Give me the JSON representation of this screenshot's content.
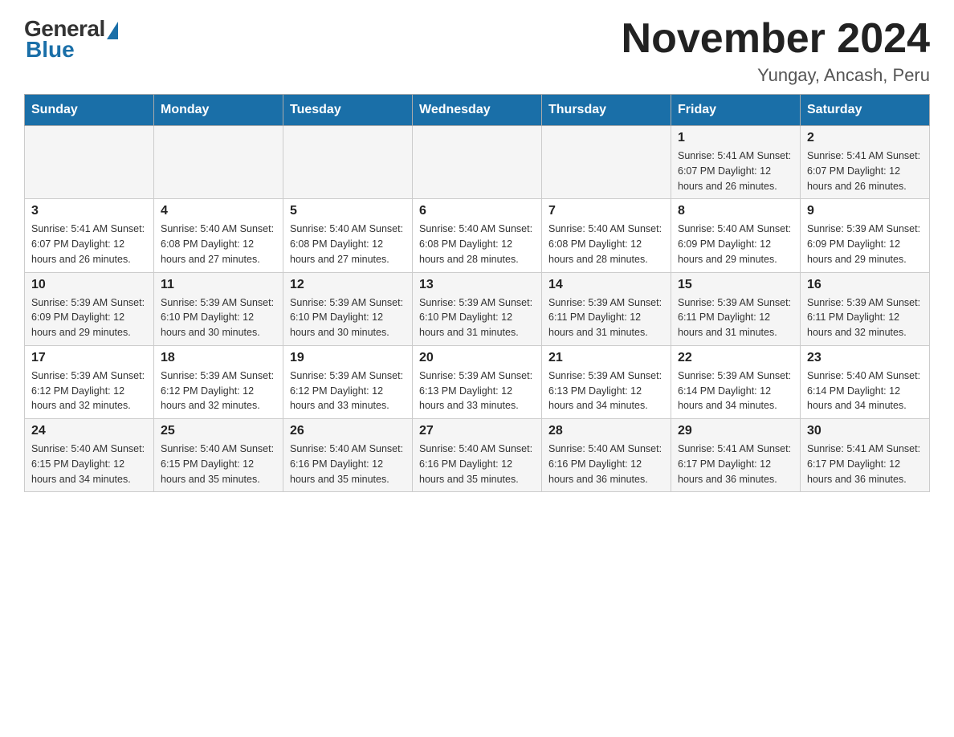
{
  "header": {
    "logo_general": "General",
    "logo_blue": "Blue",
    "month_title": "November 2024",
    "subtitle": "Yungay, Ancash, Peru"
  },
  "weekdays": [
    "Sunday",
    "Monday",
    "Tuesday",
    "Wednesday",
    "Thursday",
    "Friday",
    "Saturday"
  ],
  "weeks": [
    [
      {
        "day": "",
        "info": ""
      },
      {
        "day": "",
        "info": ""
      },
      {
        "day": "",
        "info": ""
      },
      {
        "day": "",
        "info": ""
      },
      {
        "day": "",
        "info": ""
      },
      {
        "day": "1",
        "info": "Sunrise: 5:41 AM\nSunset: 6:07 PM\nDaylight: 12 hours and 26 minutes."
      },
      {
        "day": "2",
        "info": "Sunrise: 5:41 AM\nSunset: 6:07 PM\nDaylight: 12 hours and 26 minutes."
      }
    ],
    [
      {
        "day": "3",
        "info": "Sunrise: 5:41 AM\nSunset: 6:07 PM\nDaylight: 12 hours and 26 minutes."
      },
      {
        "day": "4",
        "info": "Sunrise: 5:40 AM\nSunset: 6:08 PM\nDaylight: 12 hours and 27 minutes."
      },
      {
        "day": "5",
        "info": "Sunrise: 5:40 AM\nSunset: 6:08 PM\nDaylight: 12 hours and 27 minutes."
      },
      {
        "day": "6",
        "info": "Sunrise: 5:40 AM\nSunset: 6:08 PM\nDaylight: 12 hours and 28 minutes."
      },
      {
        "day": "7",
        "info": "Sunrise: 5:40 AM\nSunset: 6:08 PM\nDaylight: 12 hours and 28 minutes."
      },
      {
        "day": "8",
        "info": "Sunrise: 5:40 AM\nSunset: 6:09 PM\nDaylight: 12 hours and 29 minutes."
      },
      {
        "day": "9",
        "info": "Sunrise: 5:39 AM\nSunset: 6:09 PM\nDaylight: 12 hours and 29 minutes."
      }
    ],
    [
      {
        "day": "10",
        "info": "Sunrise: 5:39 AM\nSunset: 6:09 PM\nDaylight: 12 hours and 29 minutes."
      },
      {
        "day": "11",
        "info": "Sunrise: 5:39 AM\nSunset: 6:10 PM\nDaylight: 12 hours and 30 minutes."
      },
      {
        "day": "12",
        "info": "Sunrise: 5:39 AM\nSunset: 6:10 PM\nDaylight: 12 hours and 30 minutes."
      },
      {
        "day": "13",
        "info": "Sunrise: 5:39 AM\nSunset: 6:10 PM\nDaylight: 12 hours and 31 minutes."
      },
      {
        "day": "14",
        "info": "Sunrise: 5:39 AM\nSunset: 6:11 PM\nDaylight: 12 hours and 31 minutes."
      },
      {
        "day": "15",
        "info": "Sunrise: 5:39 AM\nSunset: 6:11 PM\nDaylight: 12 hours and 31 minutes."
      },
      {
        "day": "16",
        "info": "Sunrise: 5:39 AM\nSunset: 6:11 PM\nDaylight: 12 hours and 32 minutes."
      }
    ],
    [
      {
        "day": "17",
        "info": "Sunrise: 5:39 AM\nSunset: 6:12 PM\nDaylight: 12 hours and 32 minutes."
      },
      {
        "day": "18",
        "info": "Sunrise: 5:39 AM\nSunset: 6:12 PM\nDaylight: 12 hours and 32 minutes."
      },
      {
        "day": "19",
        "info": "Sunrise: 5:39 AM\nSunset: 6:12 PM\nDaylight: 12 hours and 33 minutes."
      },
      {
        "day": "20",
        "info": "Sunrise: 5:39 AM\nSunset: 6:13 PM\nDaylight: 12 hours and 33 minutes."
      },
      {
        "day": "21",
        "info": "Sunrise: 5:39 AM\nSunset: 6:13 PM\nDaylight: 12 hours and 34 minutes."
      },
      {
        "day": "22",
        "info": "Sunrise: 5:39 AM\nSunset: 6:14 PM\nDaylight: 12 hours and 34 minutes."
      },
      {
        "day": "23",
        "info": "Sunrise: 5:40 AM\nSunset: 6:14 PM\nDaylight: 12 hours and 34 minutes."
      }
    ],
    [
      {
        "day": "24",
        "info": "Sunrise: 5:40 AM\nSunset: 6:15 PM\nDaylight: 12 hours and 34 minutes."
      },
      {
        "day": "25",
        "info": "Sunrise: 5:40 AM\nSunset: 6:15 PM\nDaylight: 12 hours and 35 minutes."
      },
      {
        "day": "26",
        "info": "Sunrise: 5:40 AM\nSunset: 6:16 PM\nDaylight: 12 hours and 35 minutes."
      },
      {
        "day": "27",
        "info": "Sunrise: 5:40 AM\nSunset: 6:16 PM\nDaylight: 12 hours and 35 minutes."
      },
      {
        "day": "28",
        "info": "Sunrise: 5:40 AM\nSunset: 6:16 PM\nDaylight: 12 hours and 36 minutes."
      },
      {
        "day": "29",
        "info": "Sunrise: 5:41 AM\nSunset: 6:17 PM\nDaylight: 12 hours and 36 minutes."
      },
      {
        "day": "30",
        "info": "Sunrise: 5:41 AM\nSunset: 6:17 PM\nDaylight: 12 hours and 36 minutes."
      }
    ]
  ]
}
